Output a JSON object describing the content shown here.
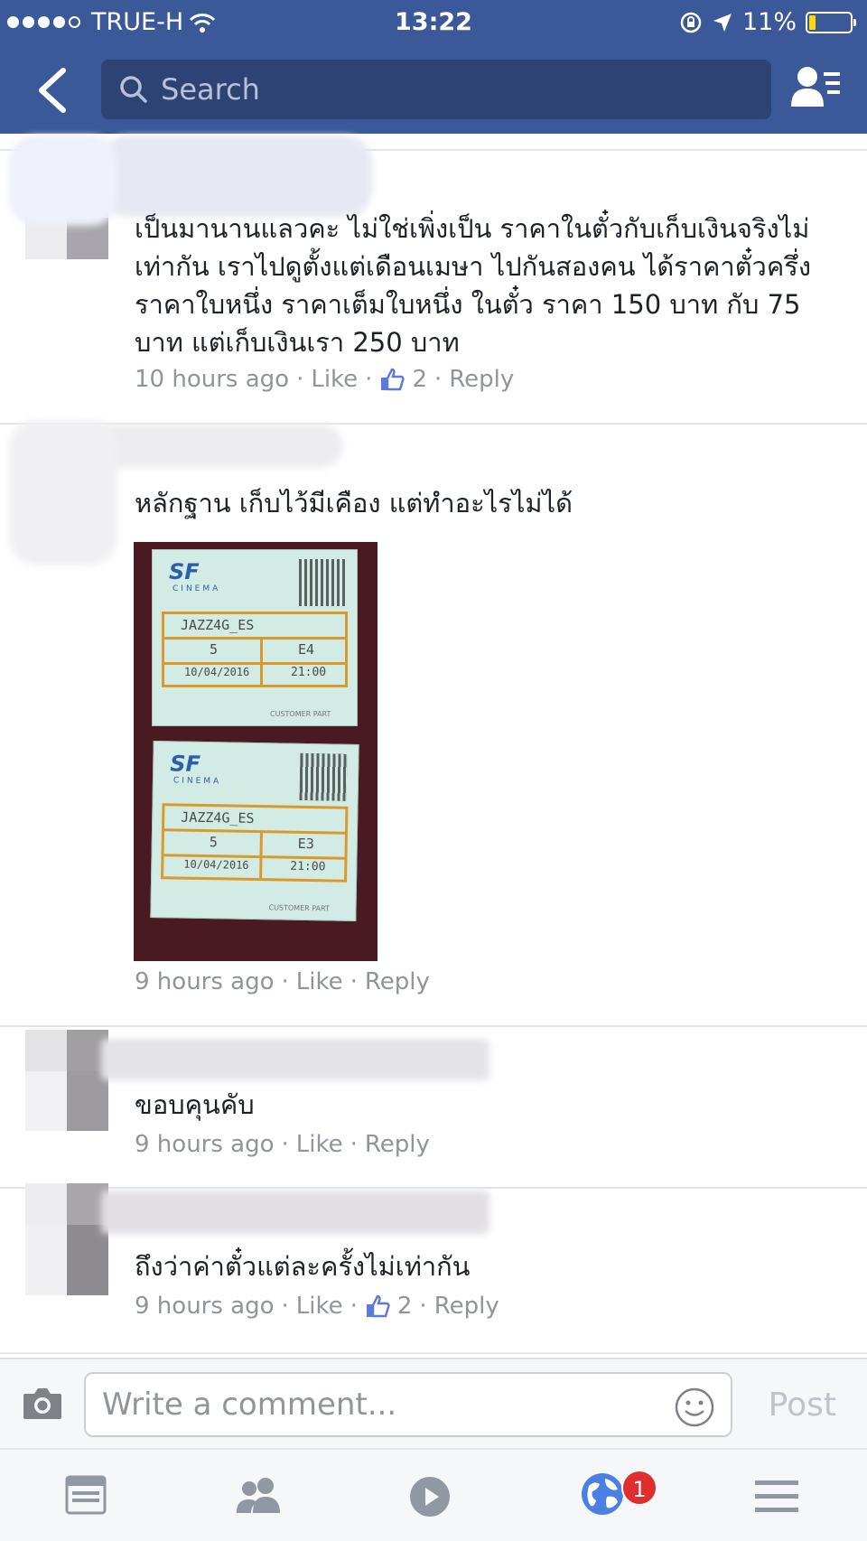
{
  "status_bar": {
    "carrier": "TRUE-H",
    "time": "13:22",
    "battery": "11%"
  },
  "nav": {
    "search_placeholder": "Search"
  },
  "comments": [
    {
      "text": "เป็นมานานแลวคะ ไม่ใช่เพิ่งเป็น ราคาในตั๋วกับเก็บเงินจริงไม่เท่ากัน เราไปดูตั้งแต่เดือนเมษา ไปกันสองคน ได้ราคาตั๋วครึ่งราคาใบหนึ่ง ราคาเต็มใบหนึ่ง ในตั๋ว ราคา 150 บาท กับ 75 บาท แต่เก็บเงินเรา 250 บาท",
      "time": "10 hours ago",
      "like": "Like",
      "likes": "2",
      "reply": "Reply"
    },
    {
      "text": "หลักฐาน เก็บไว้มีเคือง แต่ทำอะไรไม่ได้",
      "time": "9 hours ago",
      "like": "Like",
      "reply": "Reply",
      "photo": {
        "brand": "SF",
        "brand_sub": "CINEMA",
        "tickets": [
          {
            "movie": "JAZZ4G_ES",
            "theatre": "5",
            "seat": "E4",
            "date": "10/04/2016",
            "showtime": "21:00"
          },
          {
            "movie": "JAZZ4G_ES",
            "theatre": "5",
            "seat": "E3",
            "date": "10/04/2016",
            "showtime": "21:00"
          }
        ],
        "customer_part": "CUSTOMER PART"
      }
    },
    {
      "text": "ขอบคุนคับ",
      "time": "9 hours ago",
      "like": "Like",
      "reply": "Reply"
    },
    {
      "text": "ถึงว่าค่าตั๋วแต่ละครั้งไม่เท่ากัน",
      "time": "9 hours ago",
      "like": "Like",
      "likes": "2",
      "reply": "Reply"
    }
  ],
  "composer": {
    "placeholder": "Write a comment...",
    "post": "Post"
  },
  "tabs": [
    {
      "icon": "news-feed-icon"
    },
    {
      "icon": "friends-icon"
    },
    {
      "icon": "video-icon"
    },
    {
      "icon": "notifications-globe-icon",
      "badge": "1"
    },
    {
      "icon": "menu-icon"
    }
  ],
  "colors": {
    "brand_blue": "#3b5998",
    "meta_grey": "#90949c",
    "badge_red": "#e02e2e"
  }
}
